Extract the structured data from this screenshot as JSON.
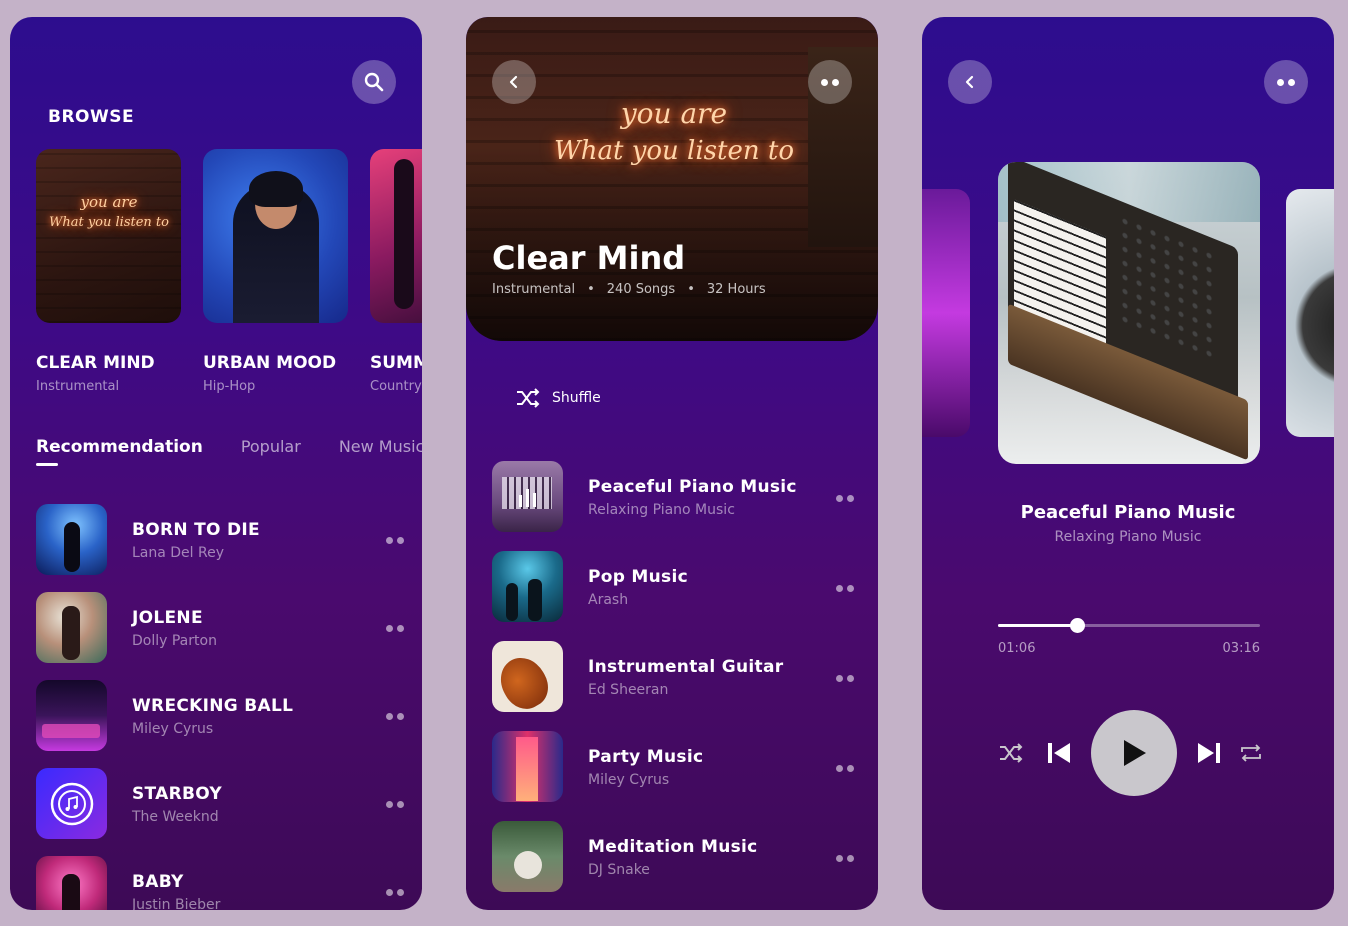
{
  "browse": {
    "title": "BROWSE",
    "cards": [
      {
        "title": "CLEAR MIND",
        "subtitle": "Instrumental"
      },
      {
        "title": "URBAN MOOD",
        "subtitle": "Hip-Hop"
      },
      {
        "title": "SUMM",
        "subtitle": "Country"
      }
    ],
    "neon_text": [
      "you are",
      "What you listen to"
    ],
    "tabs": [
      "Recommendation",
      "Popular",
      "New Music"
    ],
    "tracks": [
      {
        "title": "BORN TO DIE",
        "artist": "Lana Del Rey"
      },
      {
        "title": "JOLENE",
        "artist": "Dolly Parton"
      },
      {
        "title": "WRECKING BALL",
        "artist": "Miley Cyrus"
      },
      {
        "title": "STARBOY",
        "artist": "The Weeknd"
      },
      {
        "title": "BABY",
        "artist": "Justin Bieber"
      }
    ]
  },
  "playlist": {
    "title": "Clear Mind",
    "genre": "Instrumental",
    "songs": "240 Songs",
    "hours": "32 Hours",
    "neon_text": [
      "you are",
      "What you listen to"
    ],
    "shuffle_label": "Shuffle",
    "tracks": [
      {
        "title": "Peaceful Piano Music",
        "artist": "Relaxing Piano Music"
      },
      {
        "title": "Pop Music",
        "artist": "Arash"
      },
      {
        "title": "Instrumental Guitar",
        "artist": "Ed Sheeran"
      },
      {
        "title": "Party Music",
        "artist": "Miley Cyrus"
      },
      {
        "title": "Meditation Music",
        "artist": "DJ Snake"
      }
    ]
  },
  "player": {
    "title": "Peaceful Piano Music",
    "artist": "Relaxing Piano Music",
    "elapsed": "01:06",
    "duration": "03:16",
    "progress": 0.3
  },
  "colors": {
    "background": "#c4b2c8",
    "screen_top": "#2d0d8e",
    "screen_bottom": "#3d0a56",
    "play_button": "#c9c7cc"
  }
}
